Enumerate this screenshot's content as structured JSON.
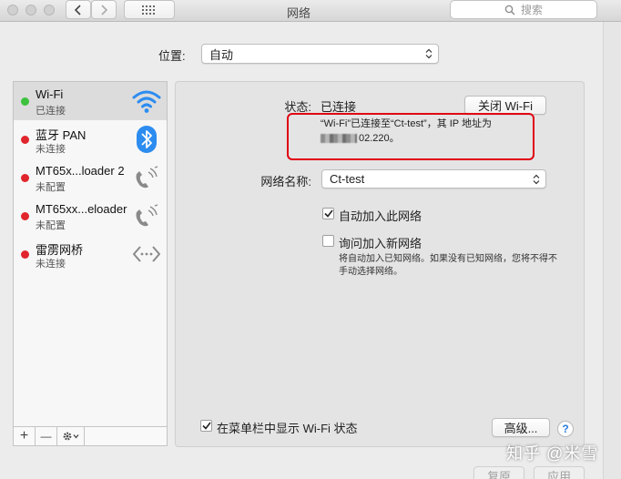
{
  "window": {
    "title": "网络",
    "search_placeholder": "搜索"
  },
  "location": {
    "label": "位置:",
    "value": "自动"
  },
  "services": [
    {
      "name": "Wi-Fi",
      "status": "已连接",
      "state_color": "#3cc23c",
      "icon": "wifi-icon",
      "selected": true
    },
    {
      "name": "蓝牙 PAN",
      "status": "未连接",
      "state_color": "#e0262c",
      "icon": "bluetooth-icon"
    },
    {
      "name": "MT65x...loader 2",
      "status": "未配置",
      "state_color": "#e0262c",
      "icon": "phone-icon"
    },
    {
      "name": "MT65xx...eloader",
      "status": "未配置",
      "state_color": "#e0262c",
      "icon": "phone-icon"
    },
    {
      "name": "雷雳网桥",
      "status": "未连接",
      "state_color": "#e0262c",
      "icon": "bridge-icon"
    }
  ],
  "sidebar_tools": {
    "add": "+",
    "remove": "—"
  },
  "detail": {
    "status_label": "状态:",
    "status_value": "已连接",
    "toggle_button": "关闭 Wi-Fi",
    "info_line1": "“Wi-Fi”已连接至“Ct-test”，其 IP 地址为",
    "info_line2": "02.220。",
    "network_name_label": "网络名称:",
    "network_name_value": "Ct-test",
    "auto_join_label": "自动加入此网络",
    "auto_join_checked": true,
    "ask_join_label": "询问加入新网络",
    "ask_join_checked": false,
    "ask_join_note": "将自动加入已知网络。如果没有已知网络，您将不得不手动选择网络。",
    "menubar_label": "在菜单栏中显示 Wi-Fi 状态",
    "menubar_checked": true,
    "advanced_button": "高级...",
    "help": "?"
  },
  "footer": {
    "revert_button": "复原",
    "apply_button": "应用"
  },
  "watermark": "知乎 @米雪",
  "colors": {
    "highlight_box": "#e00012",
    "bluetooth": "#2d8cf0",
    "wifi": "#2d8cf0"
  }
}
